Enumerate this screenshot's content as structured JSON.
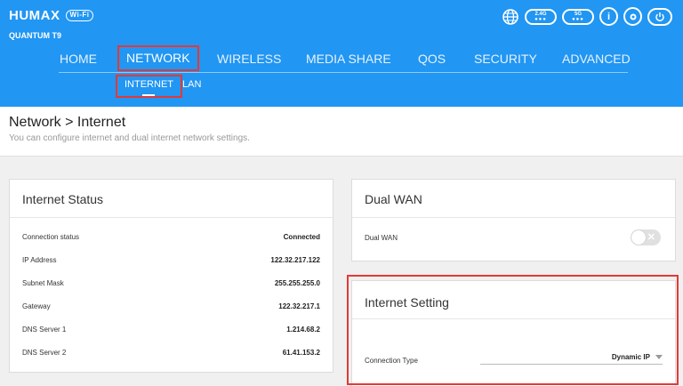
{
  "brand": {
    "logo": "HUMAX",
    "wifi_badge": "Wi-Fi",
    "model": "QUANTUM T9"
  },
  "header_icons": {
    "band24": "2.4G",
    "band5": "5G"
  },
  "nav": {
    "items": [
      {
        "label": "HOME"
      },
      {
        "label": "NETWORK"
      },
      {
        "label": "WIRELESS"
      },
      {
        "label": "MEDIA SHARE"
      },
      {
        "label": "QOS"
      },
      {
        "label": "SECURITY"
      },
      {
        "label": "ADVANCED"
      }
    ],
    "active": "NETWORK"
  },
  "subnav": {
    "items": [
      {
        "label": "INTERNET"
      },
      {
        "label": "LAN"
      }
    ],
    "active": "INTERNET"
  },
  "page": {
    "title": "Network > Internet",
    "subtitle": "You can configure internet and dual internet network settings."
  },
  "internet_status": {
    "title": "Internet Status",
    "rows": [
      {
        "label": "Connection status",
        "value": "Connected"
      },
      {
        "label": "IP Address",
        "value": "122.32.217.122"
      },
      {
        "label": "Subnet Mask",
        "value": "255.255.255.0"
      },
      {
        "label": "Gateway",
        "value": "122.32.217.1"
      },
      {
        "label": "DNS Server 1",
        "value": "1.214.68.2"
      },
      {
        "label": "DNS Server 2",
        "value": "61.41.153.2"
      }
    ]
  },
  "dual_wan": {
    "title": "Dual WAN",
    "label": "Dual WAN",
    "enabled": false
  },
  "internet_setting": {
    "title": "Internet Setting",
    "connection_type_label": "Connection Type",
    "connection_type_value": "Dynamic IP"
  },
  "colors": {
    "header": "#2196f3",
    "highlight": "#e53935"
  }
}
